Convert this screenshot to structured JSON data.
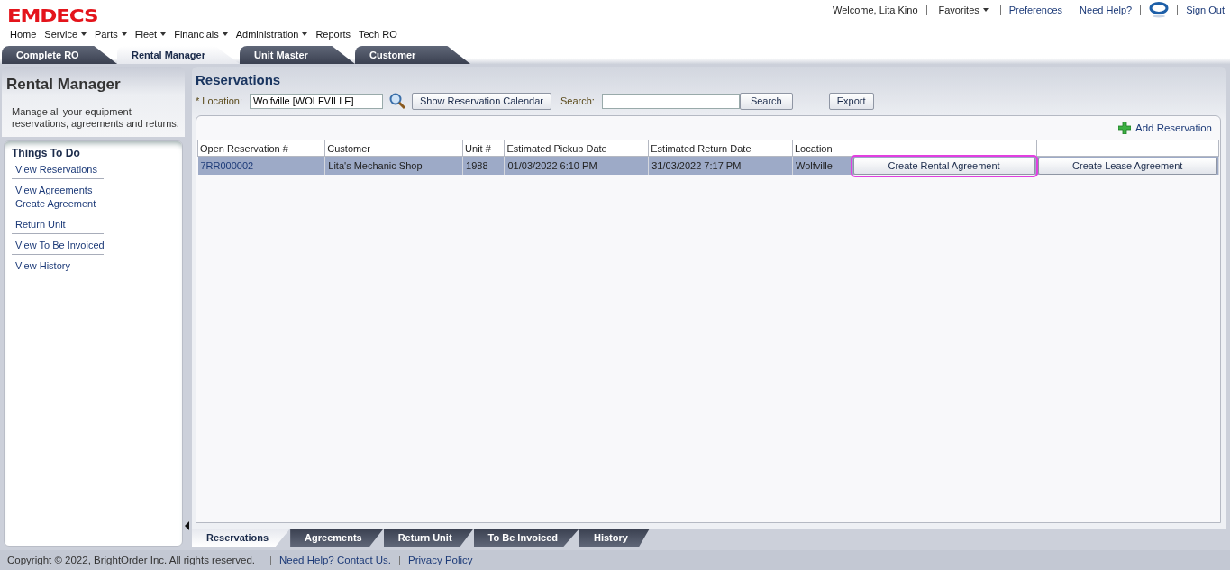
{
  "logo": "EMDECS",
  "nav": [
    {
      "label": "Home",
      "dropdown": false
    },
    {
      "label": "Service",
      "dropdown": true
    },
    {
      "label": "Parts",
      "dropdown": true
    },
    {
      "label": "Fleet",
      "dropdown": true
    },
    {
      "label": "Financials",
      "dropdown": true
    },
    {
      "label": "Administration",
      "dropdown": true
    },
    {
      "label": "Reports",
      "dropdown": false
    },
    {
      "label": "Tech RO",
      "dropdown": false
    }
  ],
  "user_bar": {
    "welcome": "Welcome, Lita Kino",
    "favorites": "Favorites",
    "preferences": "Preferences",
    "help": "Need Help?",
    "sign_out": "Sign Out"
  },
  "tabs": [
    {
      "label": "Complete RO",
      "selected": false
    },
    {
      "label": "Rental Manager",
      "selected": true
    },
    {
      "label": "Unit Master",
      "selected": false
    },
    {
      "label": "Customer",
      "selected": false
    }
  ],
  "sidebar": {
    "title": "Rental Manager",
    "description": "Manage all your equipment reservations, agreements and returns.",
    "todo_title": "Things To Do",
    "groups": [
      [
        "View Reservations"
      ],
      [
        "View Agreements",
        "Create Agreement"
      ],
      [
        "Return Unit"
      ],
      [
        "View To Be Invoiced"
      ],
      [
        "View History"
      ]
    ]
  },
  "content": {
    "title": "Reservations",
    "location_label": "* Location:",
    "location_value": "Wolfville [WOLFVILLE]",
    "calendar_button": "Show Reservation Calendar",
    "search_label": "Search:",
    "search_button": "Search",
    "export_button": "Export",
    "add_button": "Add Reservation",
    "table": {
      "columns": [
        "Open Reservation #",
        "Customer",
        "Unit #",
        "Estimated Pickup Date",
        "Estimated Return Date",
        "Location"
      ],
      "rows": [
        {
          "selected": true,
          "cells": [
            "7RR000002",
            "Lita's Mechanic Shop",
            "1988",
            "01/03/2022 6:10 PM",
            "31/03/2022 7:17 PM",
            "Wolfville"
          ],
          "actions": [
            {
              "label": "Create Rental Agreement",
              "focused": true
            },
            {
              "label": "Create Lease Agreement",
              "focused": false
            }
          ]
        }
      ]
    }
  },
  "bottom_tabs": [
    {
      "label": "Reservations",
      "selected": true
    },
    {
      "label": "Agreements",
      "selected": false
    },
    {
      "label": "Return Unit",
      "selected": false
    },
    {
      "label": "To Be Invoiced",
      "selected": false
    },
    {
      "label": "History",
      "selected": false
    }
  ],
  "footer": {
    "copyright": "Copyright © 2022, BrightOrder Inc. All rights reserved.",
    "help": "Need Help? Contact Us.",
    "privacy": "Privacy Policy"
  }
}
